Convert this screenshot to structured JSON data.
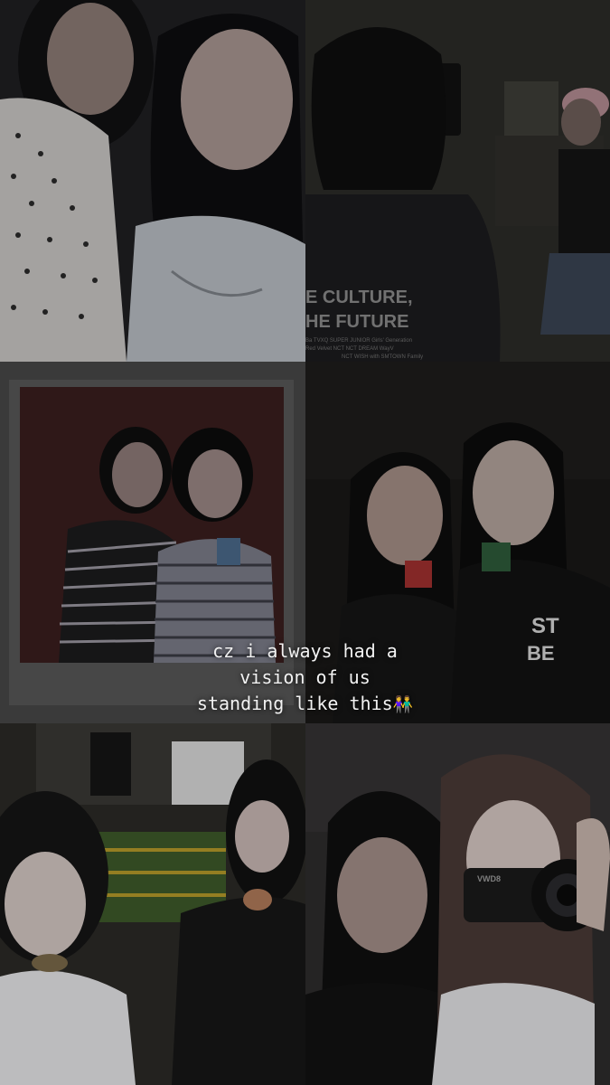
{
  "caption": {
    "line1": "cz i always had a",
    "line2": "vision of us",
    "line3": "standing like this",
    "emoji": "👫"
  },
  "photos": {
    "shirt_line1": "E CULTURE,",
    "shirt_line2": "HE FUTURE",
    "shirt_line3": "Ba  TVXQ  SUPER JUNIOR  Girls' Generation",
    "shirt_line4": "Red Velvet  NCT  NCT DREAM  WayV",
    "shirt_line5": "NCT WISH  with SMTOWN Family",
    "camera_brand": "VWD8"
  }
}
